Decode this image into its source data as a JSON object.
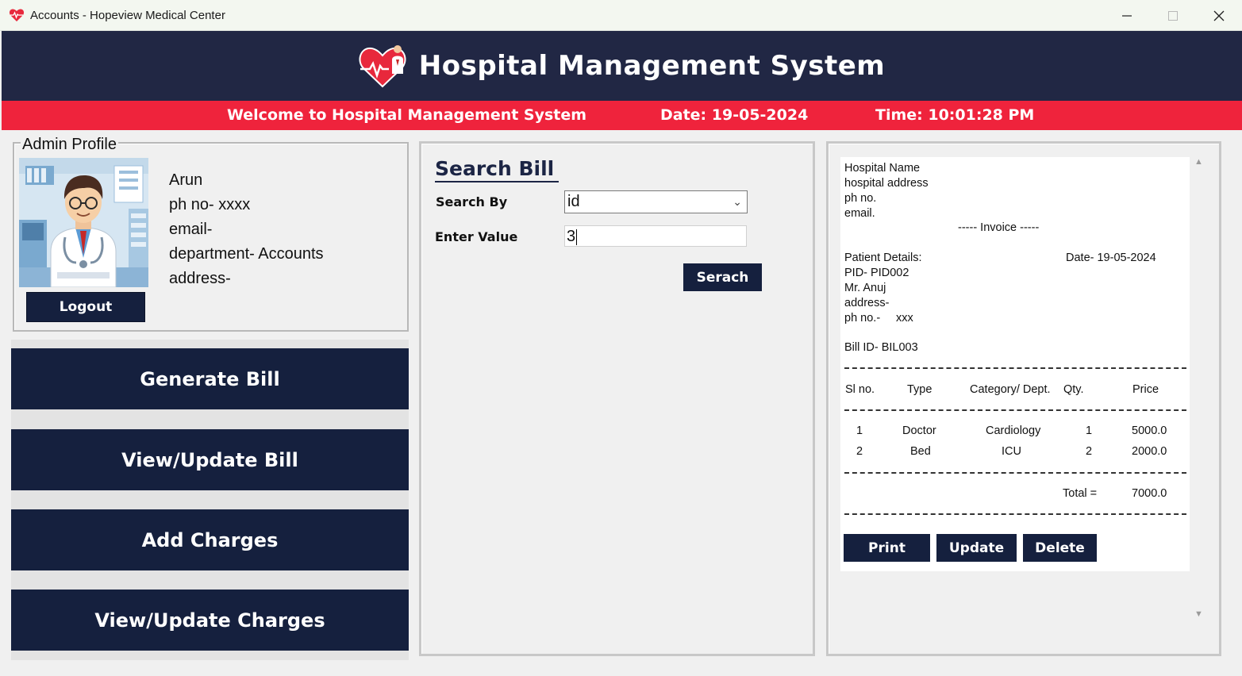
{
  "window": {
    "title": "Accounts - Hopeview Medical Center",
    "controls": [
      "minimize",
      "maximize",
      "close"
    ]
  },
  "header": {
    "title": "Hospital Management System"
  },
  "banner": {
    "welcome": "Welcome to Hospital Management System",
    "date": "Date: 19-05-2024",
    "time": "Time: 10:01:28 PM"
  },
  "profile": {
    "legend": "Admin Profile",
    "name": "Arun",
    "phone": "ph no- xxxx",
    "email": "email-",
    "department": "department- Accounts",
    "address": "address-",
    "logout_label": "Logout"
  },
  "nav": {
    "generate_bill": "Generate Bill",
    "view_update_bill": "View/Update Bill",
    "add_charges": "Add Charges",
    "view_update_charges": "View/Update Charges"
  },
  "search": {
    "title": "Search Bill",
    "search_by_label": "Search By",
    "search_by_value": "id",
    "enter_value_label": "Enter Value",
    "enter_value_value": "3",
    "search_button": "Serach"
  },
  "invoice": {
    "hospital_name": "Hospital Name",
    "hospital_address": "hospital address",
    "hospital_phone": "ph no.",
    "hospital_email": "email.",
    "heading": "----- Invoice -----",
    "patient_details_label": "Patient Details:",
    "date": "Date- 19-05-2024",
    "pid": "PID-  PID002",
    "patient_name": "Mr. Anuj",
    "patient_address": "address-",
    "patient_phone_label": "ph no.-",
    "patient_phone_value": "xxx",
    "bill_id": "Bill ID-  BIL003",
    "columns": {
      "sl": "Sl no.",
      "type": "Type",
      "category": "Category/ Dept.",
      "qty": "Qty.",
      "price": "Price"
    },
    "rows": [
      {
        "sl": "1",
        "type": "Doctor",
        "category": "Cardiology",
        "qty": "1",
        "price": "5000.0"
      },
      {
        "sl": "2",
        "type": "Bed",
        "category": "ICU",
        "qty": "2",
        "price": "2000.0"
      }
    ],
    "total_label": "Total =",
    "total_value": "7000.0",
    "print_button": "Print",
    "update_button": "Update",
    "delete_button": "Delete"
  },
  "colors": {
    "navy": "#15203e",
    "header_bg": "#212744",
    "banner_red": "#ef233c"
  }
}
